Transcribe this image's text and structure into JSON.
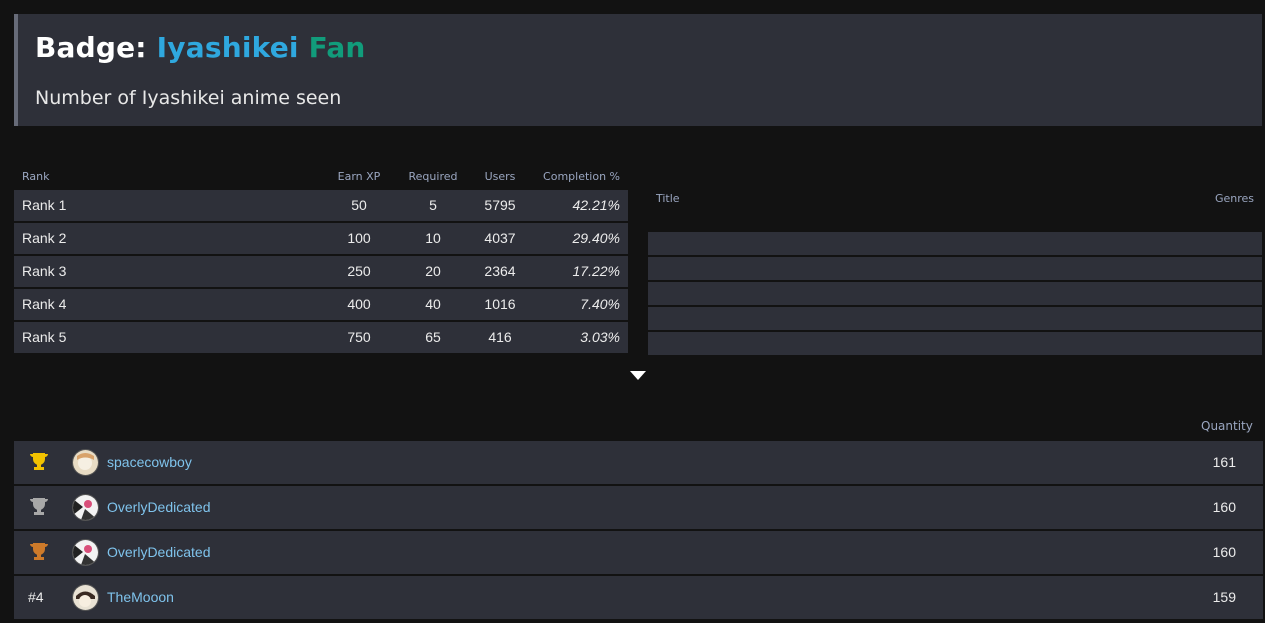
{
  "badge": {
    "prefix": "Badge:",
    "name_word1": "Iyashikei",
    "name_word2": "Fan",
    "description": "Number of Iyashikei anime seen"
  },
  "rank_table": {
    "headers": {
      "rank": "Rank",
      "xp": "Earn XP",
      "required": "Required",
      "users": "Users",
      "completion": "Completion %"
    },
    "rows": [
      {
        "rank": "Rank 1",
        "xp": "50",
        "required": "5",
        "users": "5795",
        "completion": "42.21%"
      },
      {
        "rank": "Rank 2",
        "xp": "100",
        "required": "10",
        "users": "4037",
        "completion": "29.40%"
      },
      {
        "rank": "Rank 3",
        "xp": "250",
        "required": "20",
        "users": "2364",
        "completion": "17.22%"
      },
      {
        "rank": "Rank 4",
        "xp": "400",
        "required": "40",
        "users": "1016",
        "completion": "7.40%"
      },
      {
        "rank": "Rank 5",
        "xp": "750",
        "required": "65",
        "users": "416",
        "completion": "3.03%"
      }
    ]
  },
  "anime_table": {
    "headers": {
      "title": "Title",
      "genres": "Genres"
    }
  },
  "expand_icon": "caret-down-icon",
  "leaderboard": {
    "quantity_header": "Quantity",
    "rows": [
      {
        "position_icon": "gold-trophy-icon",
        "trophy_color": "#f2c200",
        "user": "spacecowboy",
        "quantity": "161"
      },
      {
        "position_icon": "silver-trophy-icon",
        "trophy_color": "#a8a8a8",
        "user": "OverlyDedicated",
        "quantity": "160"
      },
      {
        "position_icon": "bronze-trophy-icon",
        "trophy_color": "#cd7a2a",
        "user": "OverlyDedicated",
        "quantity": "160"
      },
      {
        "position": "#4",
        "user": "TheMooon",
        "quantity": "159"
      }
    ]
  },
  "colors": {
    "accent_word1": "#2fa8df",
    "accent_word2": "#119c7b",
    "link": "#7fc3ec",
    "panel": "#2e3039",
    "background": "#121212"
  }
}
